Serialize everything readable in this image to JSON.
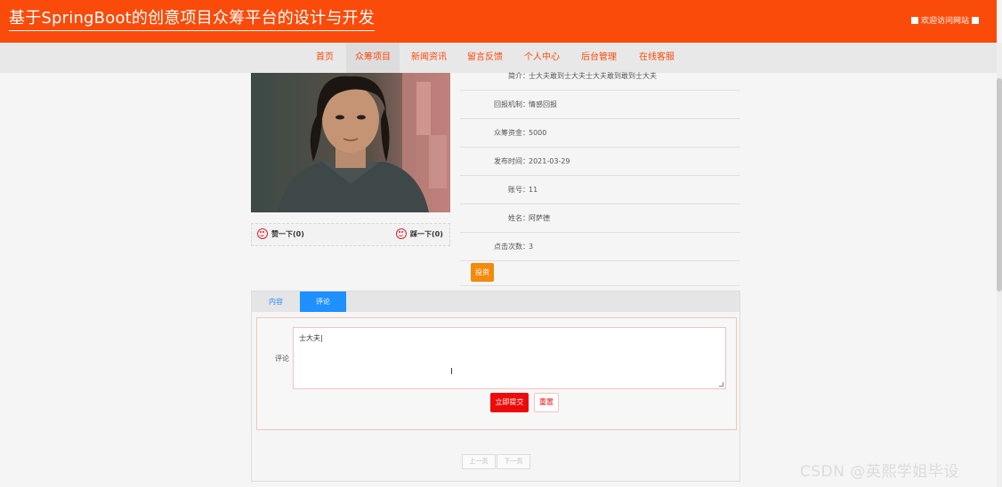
{
  "header": {
    "title": "基于SpringBoot的创意项目众筹平台的设计与开发",
    "welcome": "欢迎访问网站"
  },
  "nav": {
    "items": [
      {
        "label": "首页"
      },
      {
        "label": "众筹项目"
      },
      {
        "label": "新闻资讯"
      },
      {
        "label": "留言反馈"
      },
      {
        "label": "个人中心"
      },
      {
        "label": "后台管理"
      },
      {
        "label": "在线客服"
      }
    ],
    "active_index": 1
  },
  "project": {
    "image_icon": "portrait-photo",
    "vote": {
      "like_label": "赞一下(0)",
      "dislike_label": "踩一下(0)"
    },
    "info": [
      {
        "label": "简介：",
        "value": "士大夫敢到士大夫士大夫敢到敢到士大夫"
      },
      {
        "label": "回报机制：",
        "value": "情感回报"
      },
      {
        "label": "众筹资金：",
        "value": "5000"
      },
      {
        "label": "发布时间：",
        "value": "2021-03-29"
      },
      {
        "label": "账号：",
        "value": "11"
      },
      {
        "label": "姓名：",
        "value": "阿萨德"
      },
      {
        "label": "点击次数：",
        "value": "3"
      }
    ],
    "action_label": "投资"
  },
  "tabs": {
    "items": [
      {
        "label": "内容"
      },
      {
        "label": "评论"
      }
    ],
    "active_index": 1
  },
  "comment": {
    "label": "评论",
    "value": "士大夫",
    "submit_label": "立即提交",
    "reset_label": "重置"
  },
  "pagination": {
    "prev_label": "上一页",
    "next_label": "下一页"
  },
  "watermark": "CSDN @英熙学姐毕设",
  "colors": {
    "header_bg": "#fa4b0b",
    "tab_active": "#1e90ff",
    "submit_btn": "#ee0a0a",
    "invest_btn": "#f28a0b"
  }
}
